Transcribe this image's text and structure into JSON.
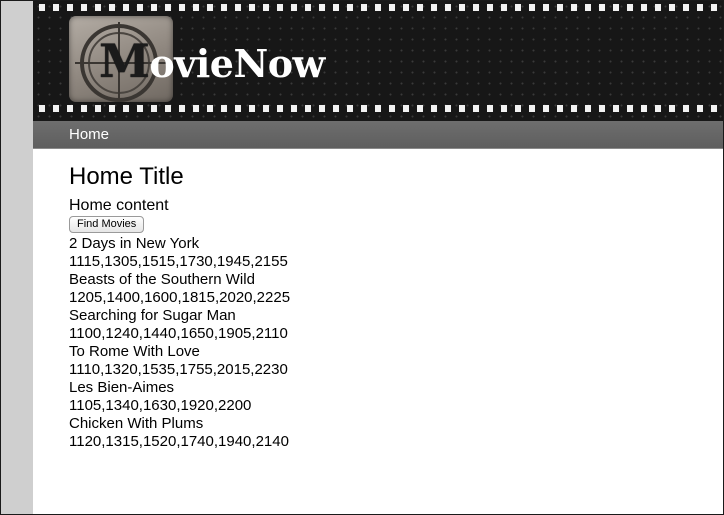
{
  "header": {
    "logo_text": "ovieNow",
    "logo_letter": "M"
  },
  "nav": {
    "home_label": "Home"
  },
  "main": {
    "title": "Home Title",
    "content": "Home content",
    "find_button_label": "Find Movies",
    "movies": [
      {
        "title": "2 Days in New York",
        "showtimes": "1115,1305,1515,1730,1945,2155"
      },
      {
        "title": "Beasts of the Southern Wild",
        "showtimes": "1205,1400,1600,1815,2020,2225"
      },
      {
        "title": "Searching for Sugar Man",
        "showtimes": "1100,1240,1440,1650,1905,2110"
      },
      {
        "title": "To Rome With Love",
        "showtimes": "1110,1320,1535,1755,2015,2230"
      },
      {
        "title": "Les Bien-Aimes",
        "showtimes": "1105,1340,1630,1920,2200"
      },
      {
        "title": "Chicken With Plums",
        "showtimes": "1120,1315,1520,1740,1940,2140"
      }
    ]
  },
  "colors": {
    "header_bg": "#171717",
    "nav_bg": "#666666",
    "gutter": "#cfcfcf"
  },
  "icons": {
    "logo": "film-reel-countdown-icon"
  }
}
